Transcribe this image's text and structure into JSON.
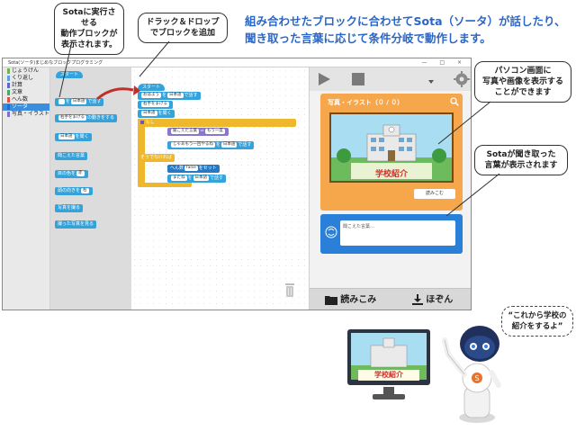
{
  "callouts": {
    "exec_block": {
      "lines": [
        "Sotaに実行させる",
        "動作ブロックが",
        "表示されます。"
      ]
    },
    "drag_drop": {
      "lines": [
        "ドラック＆ドロップ",
        "でブロックを追加"
      ]
    },
    "pc_screen": {
      "lines": [
        "パソコン画面に",
        "写真や画像を表示する",
        "ことができます"
      ]
    },
    "sota_heard": {
      "lines": [
        "Sotaが聞き取った",
        "言葉が表示されます"
      ]
    }
  },
  "headline": {
    "line1": "組み合わせたブロックに合わせてSota（ソータ）が話したり、",
    "line2": "聞き取った言葉に応じて条件分岐で動作します。"
  },
  "app": {
    "title": "Sota(ソータ)まじめなブロックプログラミング",
    "window_controls": "— □ ×",
    "categories": [
      {
        "label": "じょうけん",
        "color": "#6fb24c",
        "active": false
      },
      {
        "label": "くり返し",
        "color": "#5aa0e0",
        "active": false
      },
      {
        "label": "計算",
        "color": "#5b67c9",
        "active": false
      },
      {
        "label": "文章",
        "color": "#46a86c",
        "active": false
      },
      {
        "label": "へん数",
        "color": "#e2504c",
        "active": false
      },
      {
        "label": "ソータ",
        "color": "#1d6fd0",
        "active": true
      },
      {
        "label": "写真・イラスト",
        "color": "#8d6ac8",
        "active": false
      }
    ],
    "palette": {
      "start": "スタート",
      "b1_label": "で話す",
      "b1_field": "日本語",
      "b2_label": "の動きをする",
      "b2_field": "右手をまげる",
      "b3_label": "を聞く",
      "b3_field": "日本語",
      "b4_label": "聞こえた言葉",
      "b5_label": "目の色を",
      "b5_field": "赤",
      "b6_label": "頭の向きを",
      "b6_field": "右",
      "b7_label": "写真を撮る",
      "b8_label": "撮った写真を見る"
    },
    "workspace": {
      "start": "スタート",
      "w1_field": "おはよう",
      "w1_lang": "日本語",
      "w1_tail": "で話す",
      "w2_label": "右手をまげる",
      "w3_label": "日本語",
      "w3_tail": "を聞く",
      "w4_label": "もし",
      "w5_label": "聞こえた言葉",
      "w5_op": "＝",
      "w5_field": "もう一度",
      "w6_field": "じゃあもう一回やるね",
      "w6_lang": "日本語",
      "w6_tail": "で話す",
      "w7_label": "そうでなければ",
      "w8_label": "へん数",
      "w8_field": "false",
      "w8_tail": "をセット",
      "w9_field": "またね",
      "w9_lang": "日本語",
      "w9_tail": "で話す"
    },
    "photo_panel": {
      "title": "写真・イラスト（０ / ０）",
      "caption": "学校紹介",
      "load_label": "読みこむ"
    },
    "speech_panel": {
      "placeholder": "聞こえた言葉…"
    },
    "bottom": {
      "load": "読みこみ",
      "save": "ほぞん"
    }
  },
  "monitor": {
    "caption": "学校紹介"
  },
  "robot": {
    "speech": [
      "“これから学校の",
      "紹介をするよ”"
    ]
  },
  "colors": {
    "accent_blue": "#2a66c8",
    "photo_orange": "#f6a64b",
    "speech_blue": "#2a7fd8",
    "block_blue": "#34a3dc",
    "block_yellow": "#efb72b",
    "arrow_red": "#c0302b"
  }
}
